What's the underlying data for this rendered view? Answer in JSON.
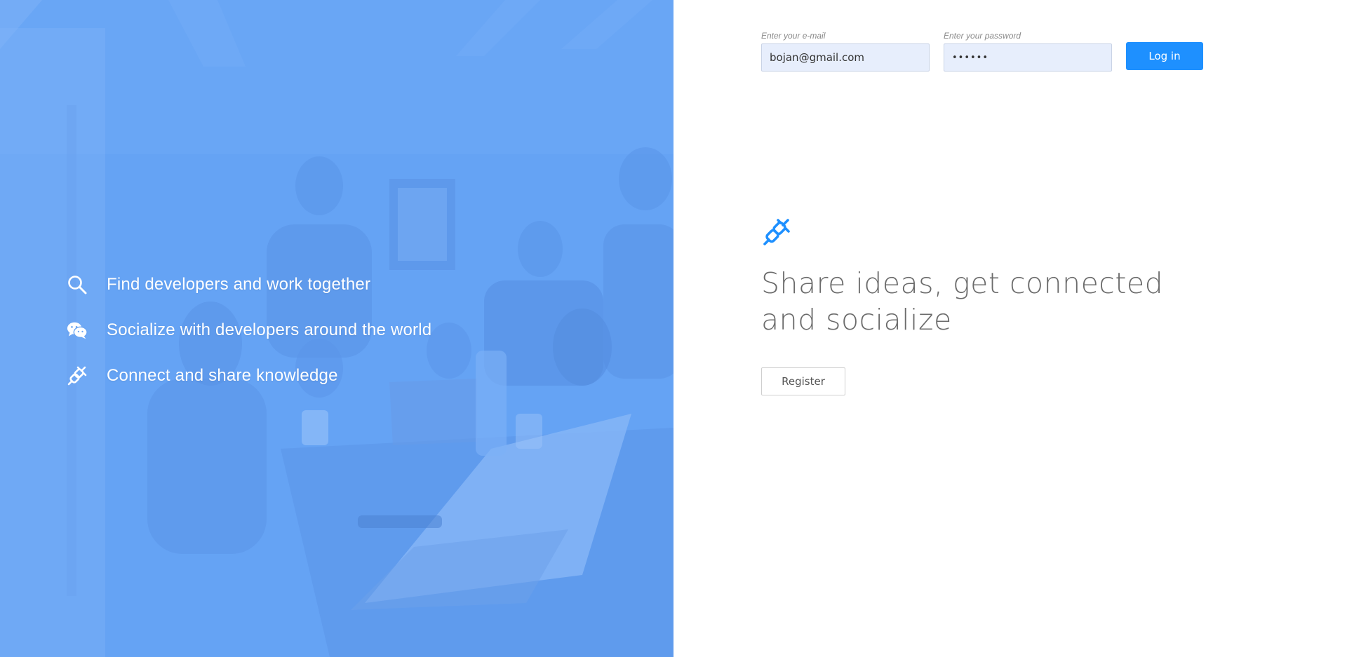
{
  "hero": {
    "features": [
      {
        "icon": "search-icon",
        "text": "Find developers and work together"
      },
      {
        "icon": "chat-bubbles-icon",
        "text": "Socialize with developers around the world"
      },
      {
        "icon": "plug-icon",
        "text": "Connect and share knowledge"
      }
    ]
  },
  "login": {
    "email_label": "Enter your e-mail",
    "email_value": "bojan@gmail.com",
    "password_label": "Enter your password",
    "password_value": "••••••",
    "login_button": "Log in"
  },
  "main": {
    "brand_icon": "plug-icon",
    "headline": "Share ideas, get connected and socialize",
    "register_button": "Register"
  },
  "colors": {
    "primary": "#1e90ff",
    "hero_tint": "#62a0f4"
  }
}
